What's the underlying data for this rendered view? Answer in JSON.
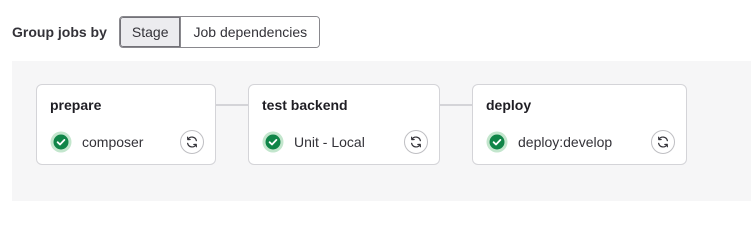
{
  "grouping": {
    "label": "Group jobs by",
    "options": [
      {
        "label": "Stage",
        "selected": true
      },
      {
        "label": "Job dependencies",
        "selected": false
      }
    ]
  },
  "stages": [
    {
      "name": "prepare",
      "jobs": [
        {
          "name": "composer",
          "status": "success",
          "icon": "check-circle-icon",
          "action_icon": "retry-icon"
        }
      ]
    },
    {
      "name": "test backend",
      "jobs": [
        {
          "name": "Unit - Local",
          "status": "success",
          "icon": "check-circle-icon",
          "action_icon": "retry-icon"
        }
      ]
    },
    {
      "name": "deploy",
      "jobs": [
        {
          "name": "deploy:develop",
          "status": "success",
          "icon": "check-circle-icon",
          "action_icon": "retry-icon"
        }
      ]
    }
  ],
  "colors": {
    "success": "#108548",
    "success_ring": "#c3e6cd",
    "stage_area_bg": "#f6f6f7"
  }
}
